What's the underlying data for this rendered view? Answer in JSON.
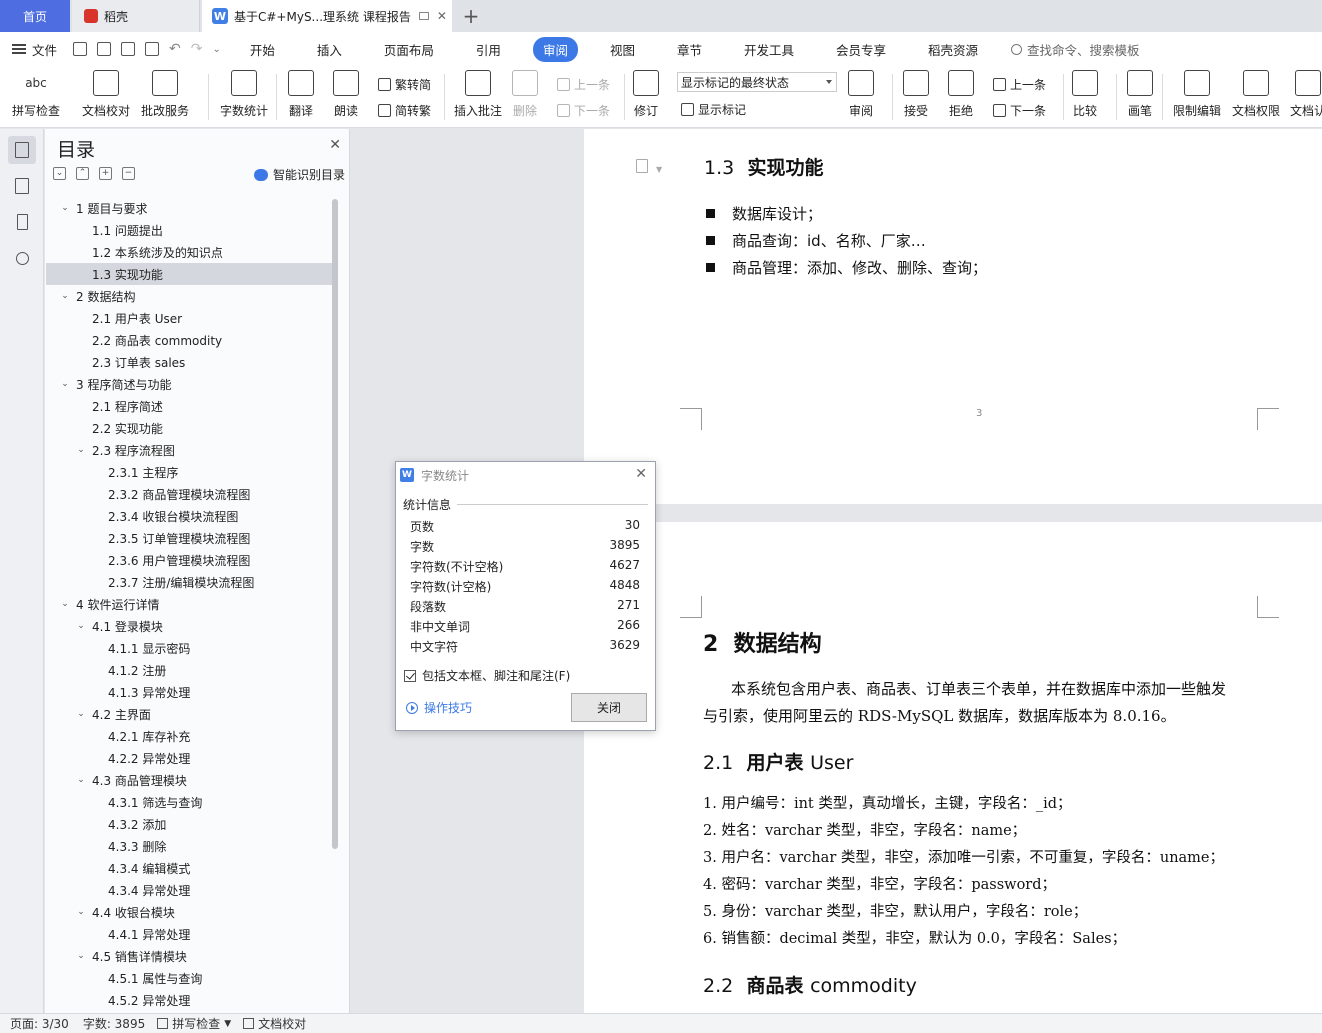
{
  "tabs": {
    "home": "首页",
    "docer": "稻壳",
    "active_doc": "基于C#+MyS...理系统 课程报告",
    "active_logo": "W"
  },
  "menu": {
    "file": "文件",
    "tabs": [
      "开始",
      "插入",
      "页面布局",
      "引用",
      "审阅",
      "视图",
      "章节",
      "开发工具",
      "会员专享",
      "稻壳资源"
    ],
    "active_tab": "审阅",
    "search": "查找命令、搜索模板"
  },
  "ribbon": {
    "spell_icon_text": "abc",
    "spell": "拼写检查",
    "doc_check": "文档校对",
    "review_service": "批改服务",
    "word_count": "字数统计",
    "translate": "翻译",
    "read_aloud": "朗读",
    "trad_simp": "繁转简",
    "simp_trad": "简转繁",
    "insert_comment": "插入批注",
    "delete": "删除",
    "prev_comment": "上一条",
    "next_comment": "下一条",
    "track": "修订",
    "markup_state": "显示标记的最终状态",
    "show_markup": "显示标记",
    "review_pane": "审阅",
    "accept": "接受",
    "reject": "拒绝",
    "prev_change": "上一条",
    "next_change": "下一条",
    "compare": "比较",
    "pen": "画笔",
    "restrict": "限制编辑",
    "permission": "文档权限",
    "doc_cert": "文档认"
  },
  "toc": {
    "title": "目录",
    "ai_button": "智能识别目录",
    "items": [
      {
        "level": 1,
        "text": "1  题目与要求",
        "chevron": "v"
      },
      {
        "level": 2,
        "text": "1.1 问题提出"
      },
      {
        "level": 2,
        "text": "1.2 本系统涉及的知识点"
      },
      {
        "level": 2,
        "text": "1.3  实现功能",
        "selected": true
      },
      {
        "level": 1,
        "text": "2  数据结构",
        "chevron": "v"
      },
      {
        "level": 2,
        "text": "2.1  用户表 User"
      },
      {
        "level": 2,
        "text": "2.2  商品表 commodity"
      },
      {
        "level": 2,
        "text": "2.3  订单表 sales"
      },
      {
        "level": 1,
        "text": "3  程序简述与功能",
        "chevron": "v"
      },
      {
        "level": 2,
        "text": "2.1  程序简述"
      },
      {
        "level": 2,
        "text": "2.2  实现功能"
      },
      {
        "level": 2,
        "text": "2.3  程序流程图",
        "chevron": "v"
      },
      {
        "level": 3,
        "text": "2.3.1  主程序"
      },
      {
        "level": 3,
        "text": "2.3.2  商品管理模块流程图"
      },
      {
        "level": 3,
        "text": "2.3.4  收银台模块流程图"
      },
      {
        "level": 3,
        "text": "2.3.5  订单管理模块流程图"
      },
      {
        "level": 3,
        "text": "2.3.6  用户管理模块流程图"
      },
      {
        "level": 3,
        "text": "2.3.7  注册/编辑模块流程图"
      },
      {
        "level": 1,
        "text": "4  软件运行详情",
        "chevron": "v"
      },
      {
        "level": 2,
        "text": "4.1  登录模块",
        "chevron": "v"
      },
      {
        "level": 3,
        "text": "4.1.1  显示密码"
      },
      {
        "level": 3,
        "text": "4.1.2  注册"
      },
      {
        "level": 3,
        "text": "4.1.3  异常处理"
      },
      {
        "level": 2,
        "text": "4.2  主界面",
        "chevron": "v"
      },
      {
        "level": 3,
        "text": "4.2.1  库存补充"
      },
      {
        "level": 3,
        "text": "4.2.2  异常处理"
      },
      {
        "level": 2,
        "text": "4.3  商品管理模块",
        "chevron": "v"
      },
      {
        "level": 3,
        "text": "4.3.1  筛选与查询"
      },
      {
        "level": 3,
        "text": "4.3.2  添加"
      },
      {
        "level": 3,
        "text": "4.3.3  删除"
      },
      {
        "level": 3,
        "text": "4.3.4  编辑模式"
      },
      {
        "level": 3,
        "text": "4.3.4  异常处理"
      },
      {
        "level": 2,
        "text": "4.4 收银台模块",
        "chevron": "v"
      },
      {
        "level": 3,
        "text": "4.4.1  异常处理"
      },
      {
        "level": 2,
        "text": "4.5  销售详情模块",
        "chevron": "v"
      },
      {
        "level": 3,
        "text": "4.5.1  属性与查询"
      },
      {
        "level": 3,
        "text": "4.5.2  异常处理"
      }
    ]
  },
  "document": {
    "section_1_3": {
      "num": "1.3",
      "title": "实现功能"
    },
    "bullets": [
      "数据库设计；",
      "商品查询：id、名称、厂家…",
      "商品管理：添加、修改、删除、查询；"
    ],
    "page_number": "3",
    "chapter_2": {
      "num": "2",
      "title": "数据结构"
    },
    "intro_line1": "本系统包含用户表、商品表、订单表三个表单，并在数据库中添加一些触发",
    "intro_line2": "与引索，使用阿里云的 RDS-MySQL 数据库，数据库版本为 8.0.16。",
    "section_2_1": {
      "num": "2.1",
      "title": "用户表",
      "en": "User"
    },
    "fields": [
      "1.  用户编号：int 类型，真动增长，主键，字段名：_id；",
      "2.  姓名：varchar 类型，非空，字段名：name；",
      "3.  用户名：varchar 类型，非空，添加唯一引索，不可重复，字段名：uname；",
      "4.  密码：varchar 类型，非空，字段名：password；",
      "5.  身份：varchar 类型，非空，默认用户，字段名：role；",
      "6.  销售额：decimal 类型，非空，默认为 0.0，字段名：Sales；"
    ],
    "section_2_2": {
      "num": "2.2",
      "title": "商品表",
      "en": "commodity"
    }
  },
  "dialog": {
    "title": "字数统计",
    "logo": "W",
    "group": "统计信息",
    "stats": [
      {
        "label": "页数",
        "value": "30"
      },
      {
        "label": "字数",
        "value": "3895"
      },
      {
        "label": "字符数(不计空格)",
        "value": "4627"
      },
      {
        "label": "字符数(计空格)",
        "value": "4848"
      },
      {
        "label": "段落数",
        "value": "271"
      },
      {
        "label": "非中文单词",
        "value": "266"
      },
      {
        "label": "中文字符",
        "value": "3629"
      }
    ],
    "include_label": "包括文本框、脚注和尾注(F)",
    "tips": "操作技巧",
    "close_button": "关闭"
  },
  "status": {
    "page": "页面: 3/30",
    "words": "字数: 3895",
    "spell": "拼写检查",
    "doc_check": "文档校对"
  },
  "colors": {
    "accent": "#3c79e6",
    "home_tab": "#4d6de0"
  }
}
